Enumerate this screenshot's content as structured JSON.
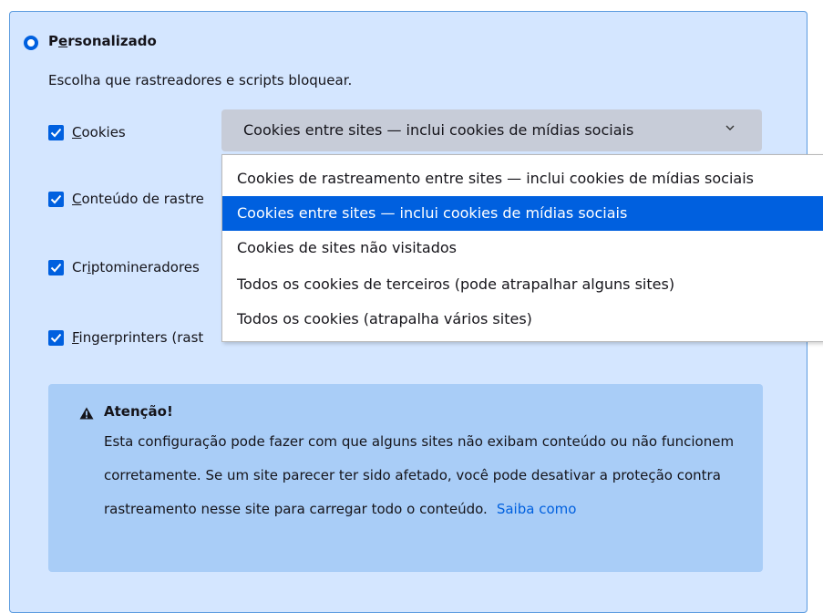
{
  "custom": {
    "title_before": "P",
    "title_accel": "e",
    "title_after": "rsonalizado",
    "description": "Escolha que rastreadores e scripts bloquear."
  },
  "checkboxes": [
    {
      "accel": "C",
      "rest": "ookies",
      "checked": true
    },
    {
      "accel": "C",
      "rest": "onteúdo de rastre",
      "checked": true
    },
    {
      "pre": "Cr",
      "accel": "i",
      "rest": "ptomineradores",
      "checked": true
    },
    {
      "accel": "F",
      "rest": "ingerprinters (rast",
      "checked": true
    }
  ],
  "cookie_select": {
    "value": "Cookies entre sites — inclui cookies de mídias sociais",
    "chevron": "chevron-down-icon"
  },
  "dropdown_options": [
    {
      "label": "Cookies de rastreamento entre sites — inclui cookies de mídias sociais",
      "selected": false
    },
    {
      "label": "Cookies entre sites — inclui cookies de mídias sociais",
      "selected": true
    },
    {
      "label": "Cookies de sites não visitados",
      "selected": false
    },
    {
      "label": "Todos os cookies de terceiros (pode atrapalhar alguns sites)",
      "selected": false
    },
    {
      "label": "Todos os cookies (atrapalha vários sites)",
      "selected": false
    }
  ],
  "warning": {
    "icon": "warning-icon",
    "title": "Atenção!",
    "body": "Esta configuração pode fazer com que alguns sites não exibam conteúdo ou não funcionem corretamente. Se um site parecer ter sido afetado, você pode desativar a proteção contra rastreamento nesse site para carregar todo o conteúdo.",
    "link": "Saiba como"
  },
  "colors": {
    "accent": "#0060df",
    "panel_bg": "#d4e6ff",
    "warning_bg": "#a9cdf7",
    "select_bg": "#c7ccd8"
  }
}
